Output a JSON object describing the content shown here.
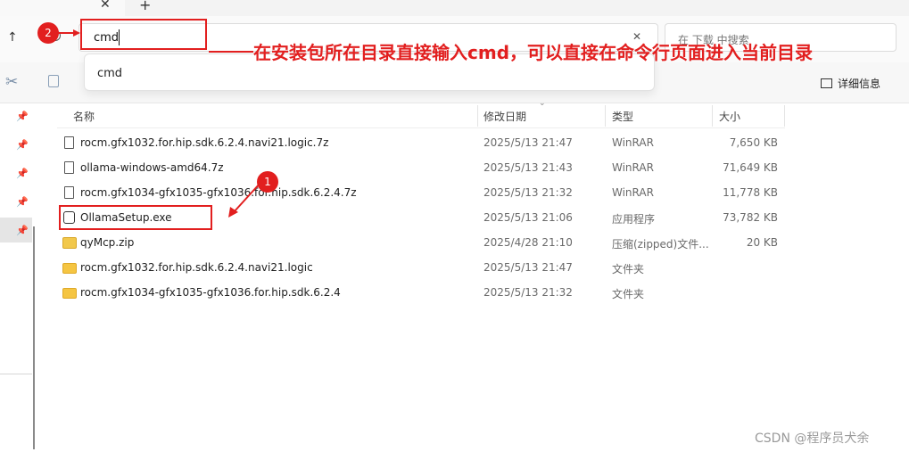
{
  "tabs": {
    "close_glyph": "✕",
    "new_glyph": "+"
  },
  "address_bar": {
    "value": "cmd",
    "clear_glyph": "✕",
    "search_placeholder": "在 下载 中搜索"
  },
  "suggestion": {
    "item": "cmd"
  },
  "toolbar": {
    "details_label": "详细信息"
  },
  "columns": {
    "name": "名称",
    "modified": "修改日期",
    "type": "类型",
    "size": "大小"
  },
  "files": [
    {
      "icon": "7z-file-icon",
      "name": "rocm.gfx1032.for.hip.sdk.6.2.4.navi21.logic.7z",
      "modified": "2025/5/13 21:47",
      "type": "WinRAR",
      "size": "7,650 KB"
    },
    {
      "icon": "7z-file-icon",
      "name": "ollama-windows-amd64.7z",
      "modified": "2025/5/13 21:43",
      "type": "WinRAR",
      "size": "71,649 KB"
    },
    {
      "icon": "7z-file-icon",
      "name": "rocm.gfx1034-gfx1035-gfx1036.for.hip.sdk.6.2.4.7z",
      "modified": "2025/5/13 21:32",
      "type": "WinRAR",
      "size": "11,778 KB"
    },
    {
      "icon": "exe-file-icon",
      "name": "OllamaSetup.exe",
      "modified": "2025/5/13 21:06",
      "type": "应用程序",
      "size": "73,782 KB"
    },
    {
      "icon": "zip-file-icon",
      "name": "qyMcp.zip",
      "modified": "2025/4/28 21:10",
      "type": "压缩(zipped)文件...",
      "size": "20 KB"
    },
    {
      "icon": "folder-icon",
      "name": "rocm.gfx1032.for.hip.sdk.6.2.4.navi21.logic",
      "modified": "2025/5/13 21:47",
      "type": "文件夹",
      "size": ""
    },
    {
      "icon": "folder-icon",
      "name": "rocm.gfx1034-gfx1035-gfx1036.for.hip.sdk.6.2.4",
      "modified": "2025/5/13 21:32",
      "type": "文件夹",
      "size": ""
    }
  ],
  "annotations": {
    "badge_1": "1",
    "badge_2": "2",
    "callout": "在安装包所在目录直接输入cmd，可以直接在命令行页面进入当前目录",
    "accent_color": "#e21f1f"
  },
  "watermark": "CSDN @程序员犬余"
}
